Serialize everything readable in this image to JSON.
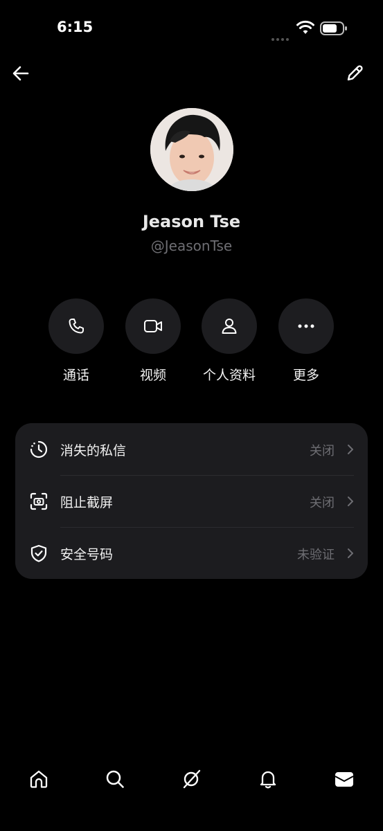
{
  "status_bar": {
    "time": "6:15"
  },
  "profile": {
    "name": "Jeason Tse",
    "handle": "@JeasonTse"
  },
  "actions": [
    {
      "label": "通话",
      "icon": "phone-icon"
    },
    {
      "label": "视频",
      "icon": "video-icon"
    },
    {
      "label": "个人资料",
      "icon": "person-icon"
    },
    {
      "label": "更多",
      "icon": "more-icon"
    }
  ],
  "settings": [
    {
      "label": "消失的私信",
      "value": "关闭",
      "icon": "timer-icon"
    },
    {
      "label": "阻止截屏",
      "value": "关闭",
      "icon": "screenshot-icon"
    },
    {
      "label": "安全号码",
      "value": "未验证",
      "icon": "shield-check-icon"
    }
  ],
  "bottom_nav": [
    "home-icon",
    "search-icon",
    "grok-icon",
    "bell-icon",
    "mail-icon"
  ],
  "colors": {
    "background": "#000000",
    "card": "#1c1c1f",
    "button": "#1d1d20",
    "muted_text": "#6e6e73"
  }
}
